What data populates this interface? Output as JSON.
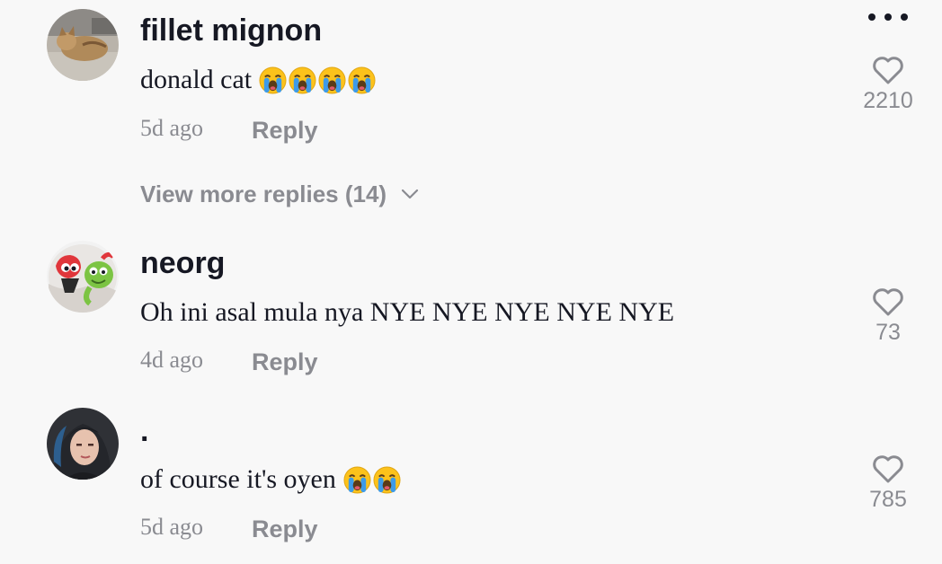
{
  "header": {
    "more_icon": "more-horizontal-icon"
  },
  "comments": [
    {
      "username": "fillet mignon",
      "text": "donald cat",
      "emoji_count": 4,
      "time": "5d ago",
      "reply_label": "Reply",
      "likes": "2210",
      "avatar": "cat-photo"
    },
    {
      "username": "neorg",
      "text": "Oh ini asal mula nya NYE NYE NYE NYE NYE",
      "emoji_count": 0,
      "time": "4d ago",
      "reply_label": "Reply",
      "likes": "73",
      "avatar": "cartoon-characters"
    },
    {
      "username": ".",
      "text": "of course it's oyen",
      "emoji_count": 2,
      "time": "5d ago",
      "reply_label": "Reply",
      "likes": "785",
      "avatar": "person-photo"
    }
  ],
  "view_more_replies": "View more replies (14)",
  "colors": {
    "background": "#f8f8f8",
    "text_primary": "#161823",
    "text_secondary": "#8a8b91",
    "emoji_face": "#fcc21b",
    "emoji_tears": "#3d9be9"
  }
}
